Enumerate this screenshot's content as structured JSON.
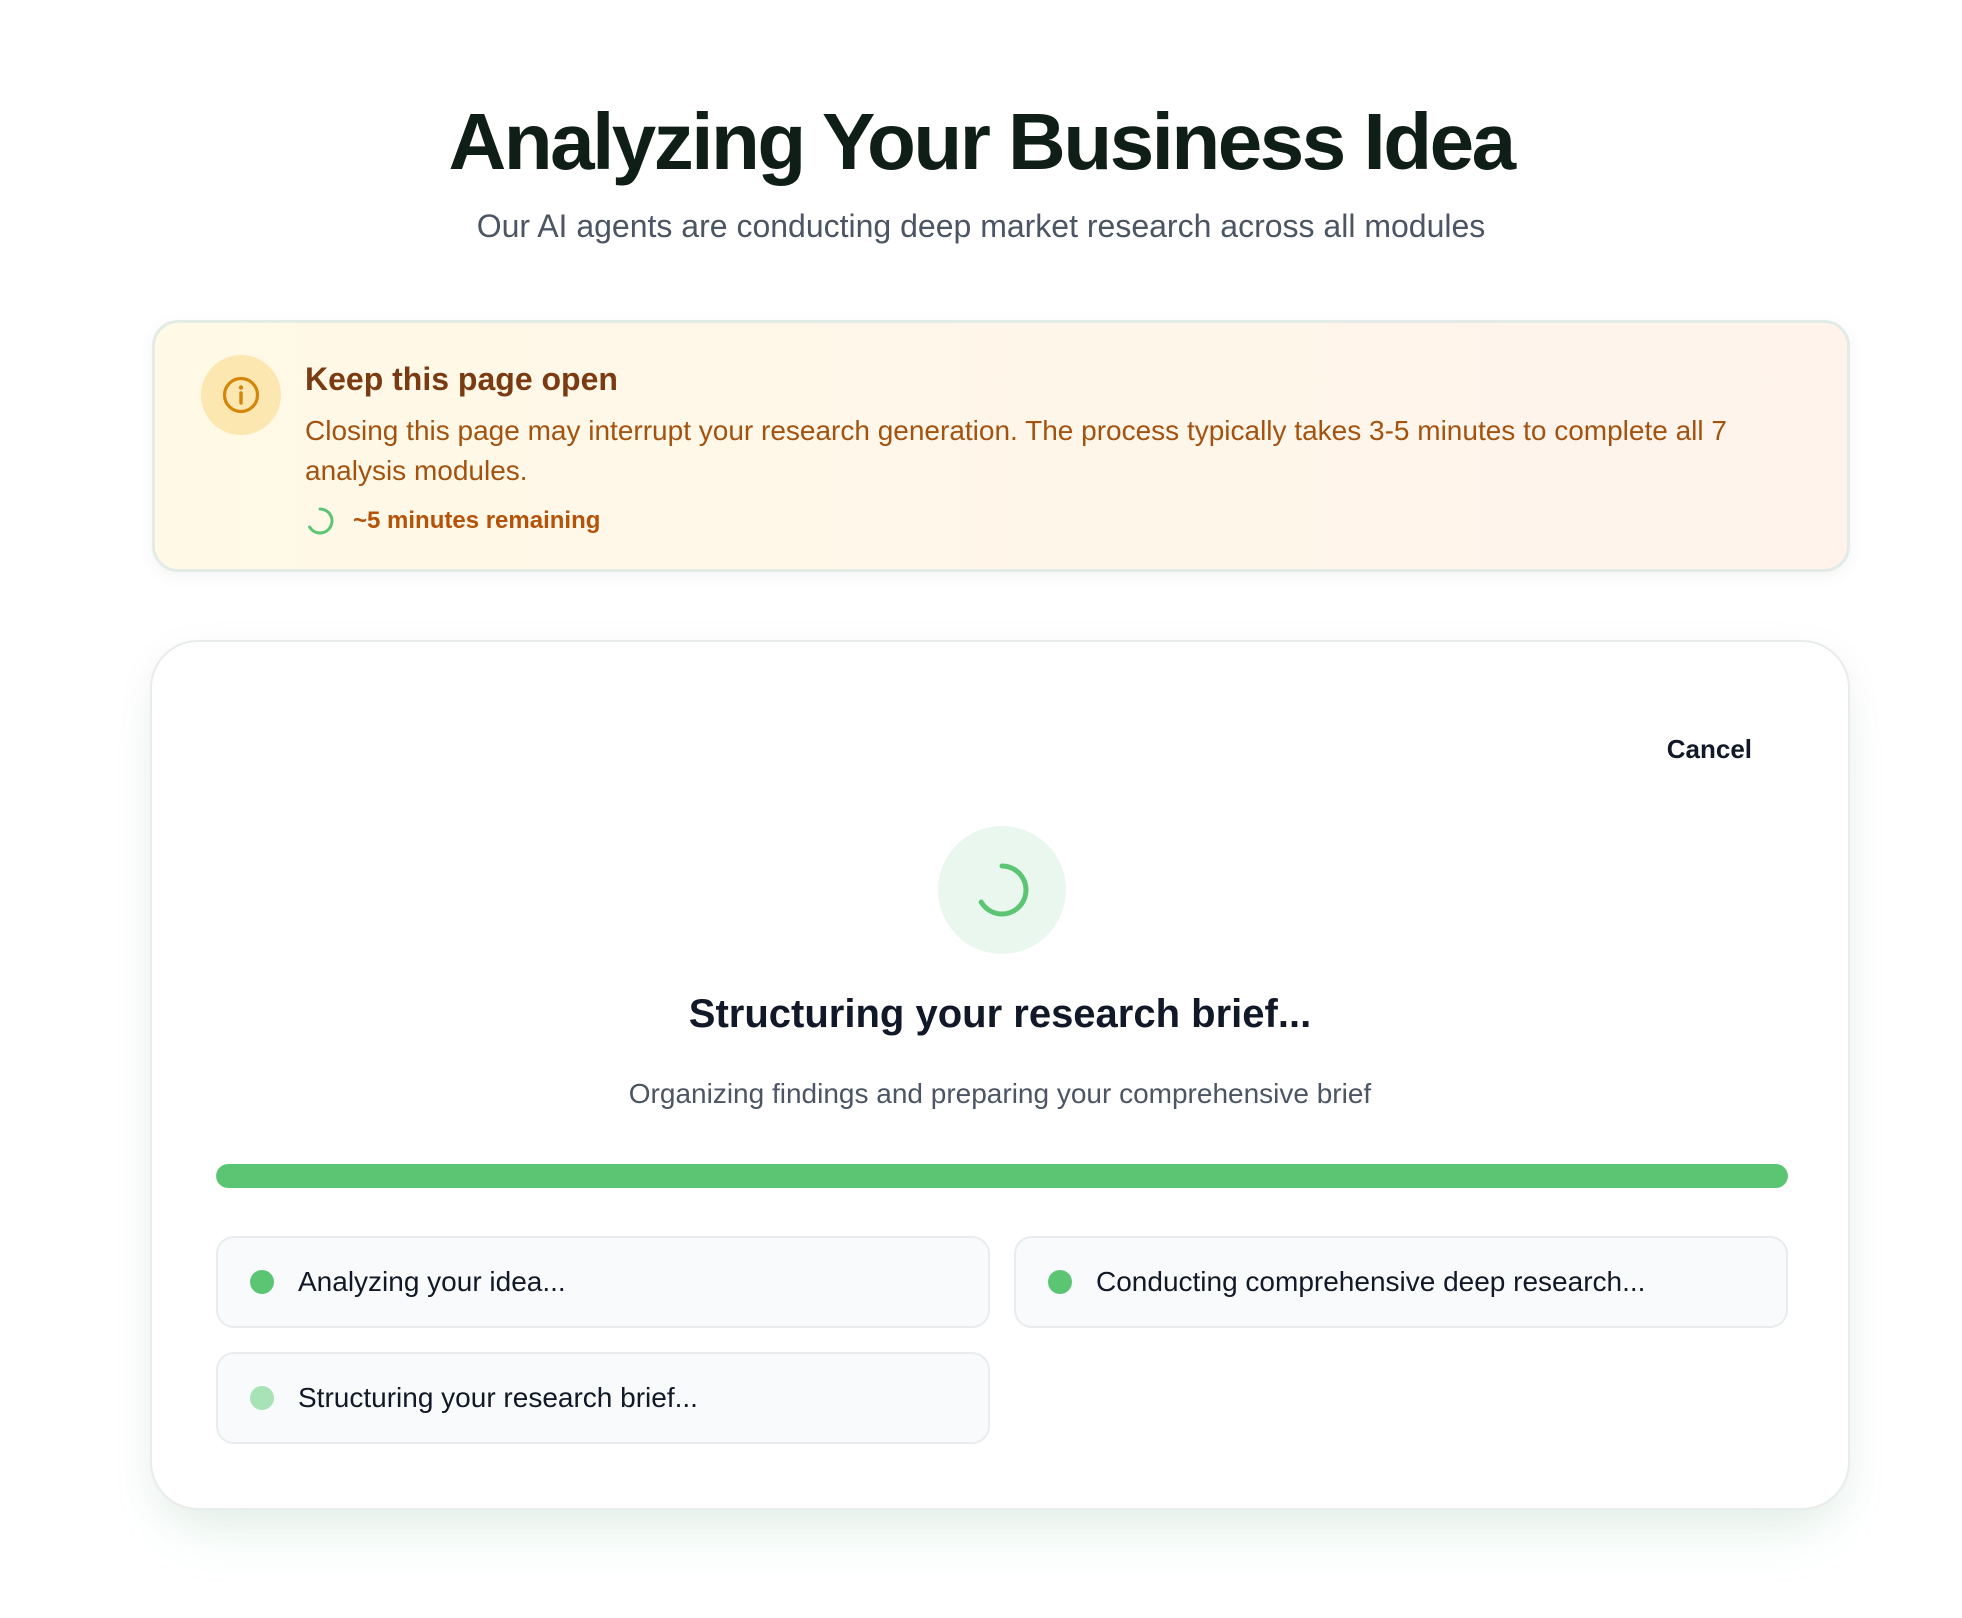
{
  "header": {
    "title": "Analyzing Your Business Idea",
    "subtitle": "Our AI agents are conducting deep market research across all modules"
  },
  "notice": {
    "icon": "info-icon",
    "title": "Keep this page open",
    "body": "Closing this page may interrupt your research generation. The process typically takes 3-5 minutes to complete all 7 analysis modules.",
    "eta_icon": "spinner-icon",
    "eta": "~5 minutes remaining"
  },
  "card": {
    "cancel_label": "Cancel",
    "spinner_icon": "spinner-icon",
    "status_title": "Structuring your research brief...",
    "status_subtitle": "Organizing findings and preparing your comprehensive brief",
    "progress_fraction": 1.0,
    "steps": [
      {
        "label": "Analyzing your idea...",
        "state": "complete",
        "dot_color": "#5cc574"
      },
      {
        "label": "Conducting comprehensive deep research...",
        "state": "complete",
        "dot_color": "#5cc574"
      },
      {
        "label": "Structuring your research brief...",
        "state": "active",
        "dot_color": "#a8e3b7"
      }
    ]
  },
  "colors": {
    "accent_green": "#5cc574",
    "notice_title": "#7a3b12",
    "notice_text": "#a3530f",
    "info_icon": "#d4860b"
  }
}
